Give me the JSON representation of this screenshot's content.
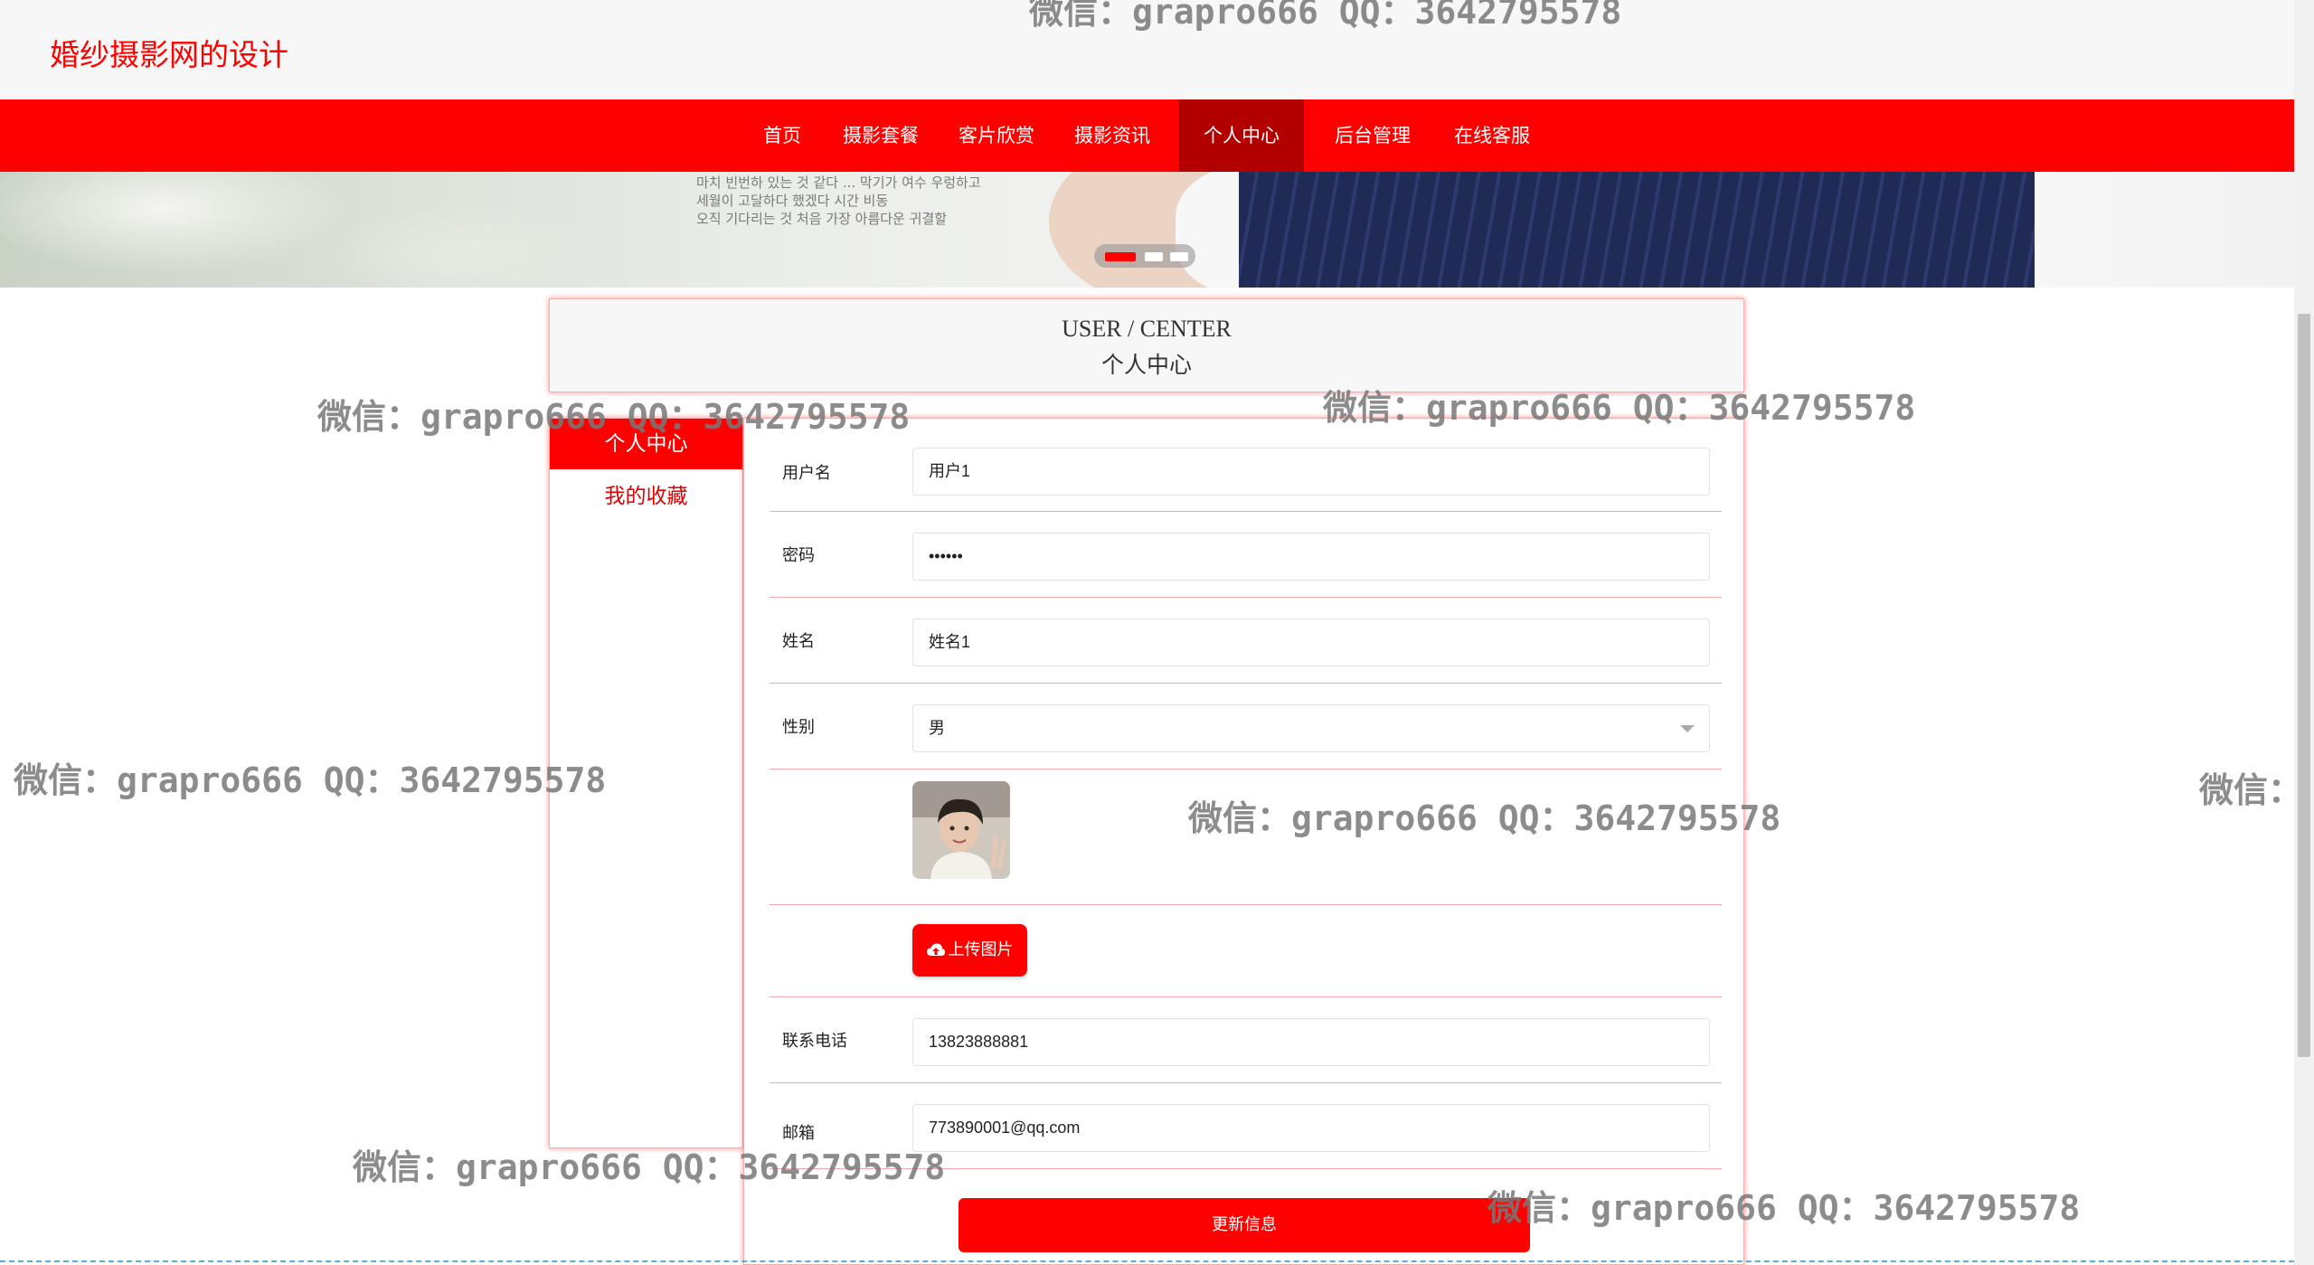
{
  "site": {
    "title": "婚纱摄影网的设计"
  },
  "nav": {
    "items": [
      {
        "label": "首页"
      },
      {
        "label": "摄影套餐"
      },
      {
        "label": "客片欣赏"
      },
      {
        "label": "摄影资讯"
      },
      {
        "label": "个人中心",
        "active": true
      },
      {
        "label": "后台管理"
      },
      {
        "label": "在线客服"
      }
    ]
  },
  "banner": {
    "text_lines": [
      "마치 빈번하 있는 것 같다 ... 막기가 여수 우렁하고",
      "세월이 고달하다 했겠다 시간 비동",
      "오직 기다리는 것 처음 가장 아름다운 귀결할"
    ],
    "slides": 3,
    "active_slide": 1
  },
  "page": {
    "title_en": "USER / CENTER",
    "title_cn": "个人中心"
  },
  "sidebar": {
    "items": [
      {
        "label": "个人中心",
        "active": true
      },
      {
        "label": "我的收藏"
      }
    ]
  },
  "form": {
    "username": {
      "label": "用户名",
      "value": "用户1"
    },
    "password": {
      "label": "密码",
      "value": "••••••"
    },
    "name": {
      "label": "姓名",
      "value": "姓名1"
    },
    "gender": {
      "label": "性别",
      "value": "男"
    },
    "upload_label": "上传图片",
    "phone": {
      "label": "联系电话",
      "value": "13823888881"
    },
    "email": {
      "label": "邮箱",
      "value": "773890001@qq.com"
    },
    "submit_label": "更新信息"
  },
  "watermark": {
    "text": "微信：grapro666 QQ：3642795578",
    "partial_text": "微信："
  },
  "colors": {
    "primary": "#ff0000",
    "nav_active": "#b20000",
    "header_bg": "#f7f7f7"
  }
}
